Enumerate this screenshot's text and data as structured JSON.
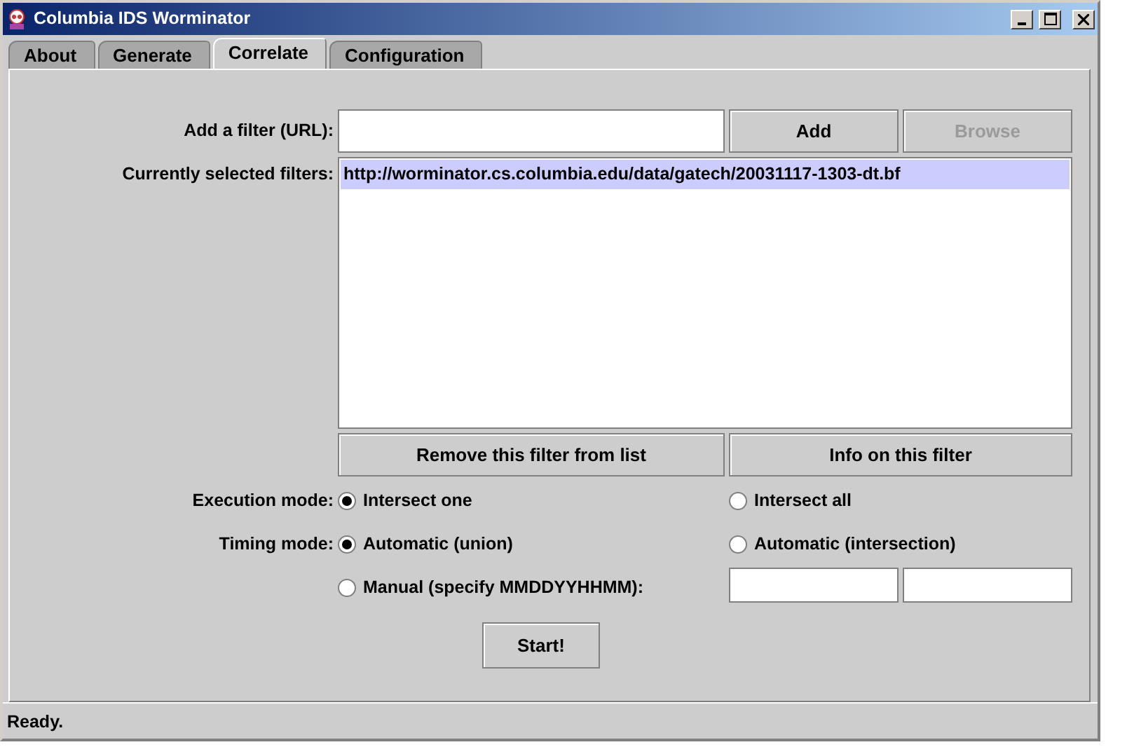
{
  "window": {
    "title": "Columbia IDS Worminator"
  },
  "tabs": [
    {
      "label": "About",
      "selected": false
    },
    {
      "label": "Generate",
      "selected": false
    },
    {
      "label": "Correlate",
      "selected": true
    },
    {
      "label": "Configuration",
      "selected": false
    }
  ],
  "filter_url": {
    "label": "Add a filter (URL):",
    "add_button": {
      "label": "Add",
      "disabled": false
    },
    "browse_button": {
      "label": "Browse",
      "disabled": true
    }
  },
  "filters": {
    "label": "Currently selected filters:",
    "items": [
      {
        "text": "http://worminator.cs.columbia.edu/data/gatech/20031117-1303-dt.bf",
        "selected": true
      }
    ]
  },
  "filter_buttons": [
    {
      "label": "Remove this filter from list"
    },
    {
      "label": "Info on this filter"
    }
  ],
  "execution_mode": {
    "label": "Execution mode:",
    "options": [
      {
        "label": "Intersect one",
        "selected": true
      },
      {
        "label": "Intersect all",
        "selected": false
      }
    ]
  },
  "timing_mode": {
    "label": "Timing mode:",
    "options": [
      {
        "label": "Automatic (union)",
        "selected": true
      },
      {
        "label": "Automatic (intersection)",
        "selected": false
      },
      {
        "label": "Manual (specify MMDDYYHHMM):",
        "selected": false
      }
    ]
  },
  "start_button": {
    "label": "Start!"
  },
  "status_bar": "Ready."
}
